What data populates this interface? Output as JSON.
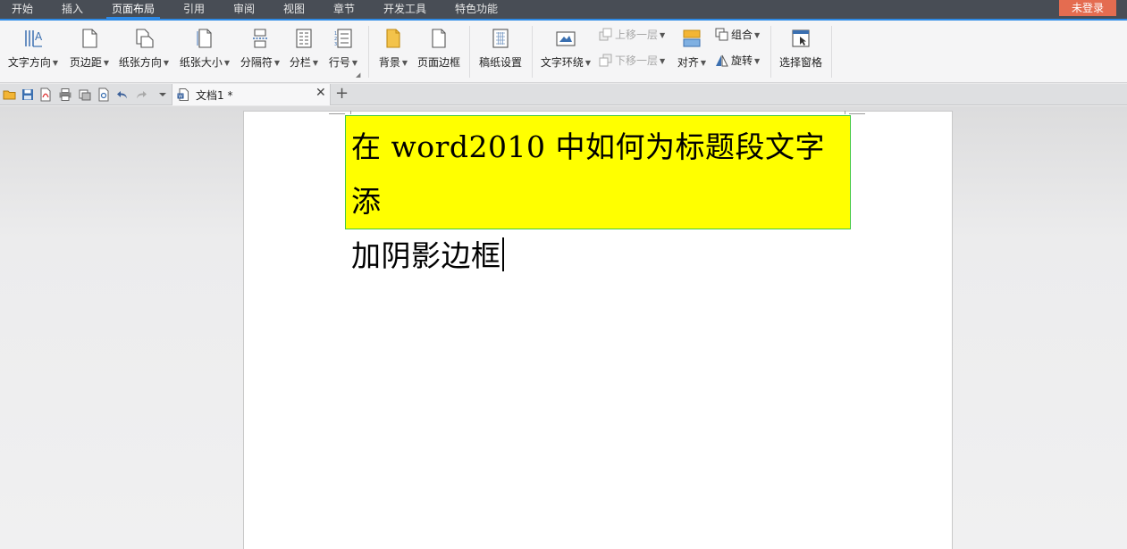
{
  "menubar": {
    "tabs": [
      {
        "label": "开始"
      },
      {
        "label": "插入"
      },
      {
        "label": "页面布局"
      },
      {
        "label": "引用"
      },
      {
        "label": "审阅"
      },
      {
        "label": "视图"
      },
      {
        "label": "章节"
      },
      {
        "label": "开发工具"
      },
      {
        "label": "特色功能"
      }
    ],
    "active_tab": "页面布局",
    "login_label": "未登录"
  },
  "ribbon": {
    "text_direction": "文字方向",
    "margins": "页边距",
    "orientation": "纸张方向",
    "paper_size": "纸张大小",
    "breaks": "分隔符",
    "columns": "分栏",
    "line_numbers": "行号",
    "background": "背景",
    "page_borders": "页面边框",
    "manuscript_settings": "稿纸设置",
    "text_wrapping": "文字环绕",
    "bring_forward": "上移一层",
    "send_backward": "下移一层",
    "align": "对齐",
    "group": "组合",
    "rotate": "旋转",
    "selection_pane": "选择窗格"
  },
  "doctabs": {
    "active_document": "文档1 *"
  },
  "document": {
    "title_line1": "在 word2010 中如何为标题段文字添",
    "title_line2": "加阴影边框"
  },
  "colors": {
    "menubar_bg": "#484d55",
    "accent_blue": "#2e8ae6",
    "login_bg": "#e46c50",
    "highlight_yellow": "#ffff00",
    "box_border_green": "#43c943"
  }
}
